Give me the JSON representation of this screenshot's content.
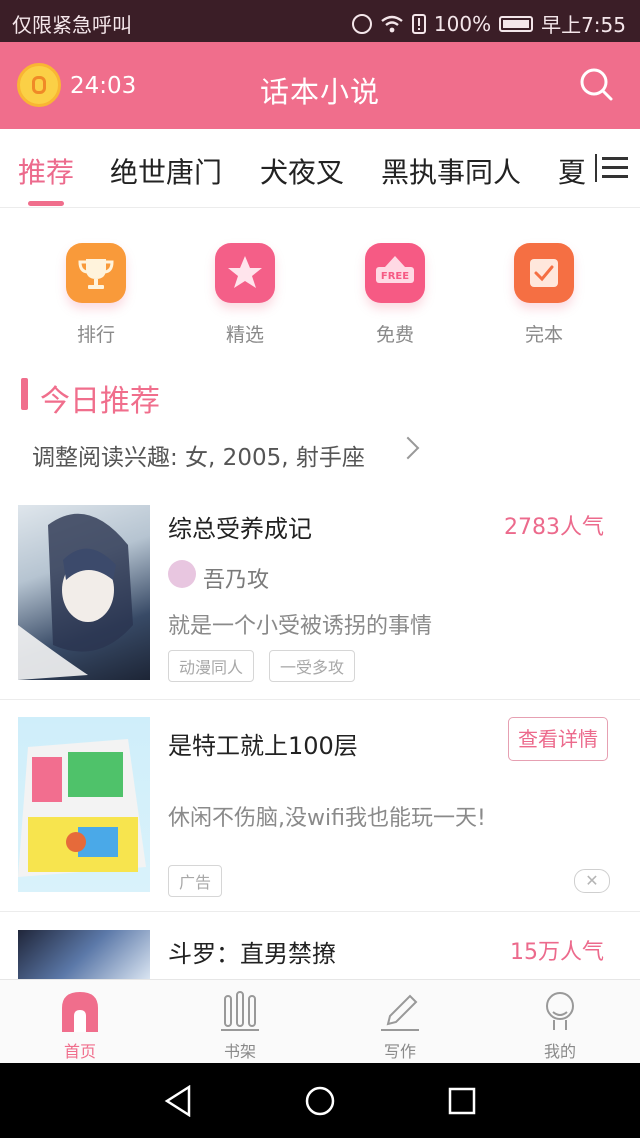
{
  "status_bar": {
    "carrier_text": "仅限紧急呼叫",
    "battery": "100%",
    "time": "早上7:55",
    "icons": [
      "alarm-icon",
      "wifi-icon",
      "sim-alert-icon",
      "battery-icon"
    ]
  },
  "header": {
    "timer": "24:03",
    "title": "话本小说",
    "icons": [
      "timer-coin-icon",
      "search-icon"
    ]
  },
  "tabs": [
    {
      "label": "推荐",
      "active": true
    },
    {
      "label": "绝世唐门"
    },
    {
      "label": "犬夜叉"
    },
    {
      "label": "黑执事同人"
    },
    {
      "label": "夏"
    }
  ],
  "quick_actions": [
    {
      "label": "排行",
      "icon": "trophy-icon",
      "color": "#f99a3a"
    },
    {
      "label": "精选",
      "icon": "star-icon",
      "color": "#f45f88"
    },
    {
      "label": "免费",
      "icon": "free-icon",
      "color": "#f65a84"
    },
    {
      "label": "完本",
      "icon": "check-icon",
      "color": "#f56f43"
    }
  ],
  "section": {
    "title": "今日推荐",
    "interest": "调整阅读兴趣: 女, 2005, 射手座"
  },
  "books": [
    {
      "title": "综总受养成记",
      "popularity": "2783人气",
      "author": "吾乃攻",
      "description": "就是一个小受被诱拐的事情",
      "tags": [
        "动漫同人",
        "一受多攻"
      ]
    },
    {
      "title": "是特工就上100层",
      "description": "休闲不伤脑,没wifi我也能玩一天!",
      "action": "查看详情",
      "tag": "广告",
      "is_ad": true
    },
    {
      "title": "斗罗：直男禁撩",
      "popularity": "15万人气"
    }
  ],
  "bottom_nav": [
    {
      "label": "首页",
      "icon": "home-icon",
      "active": true
    },
    {
      "label": "书架",
      "icon": "bookshelf-icon"
    },
    {
      "label": "写作",
      "icon": "pen-icon"
    },
    {
      "label": "我的",
      "icon": "profile-icon"
    }
  ],
  "colors": {
    "accent": "#f06e8c",
    "status_bar": "#3b1e27",
    "popularity": "#ec6a8c"
  }
}
